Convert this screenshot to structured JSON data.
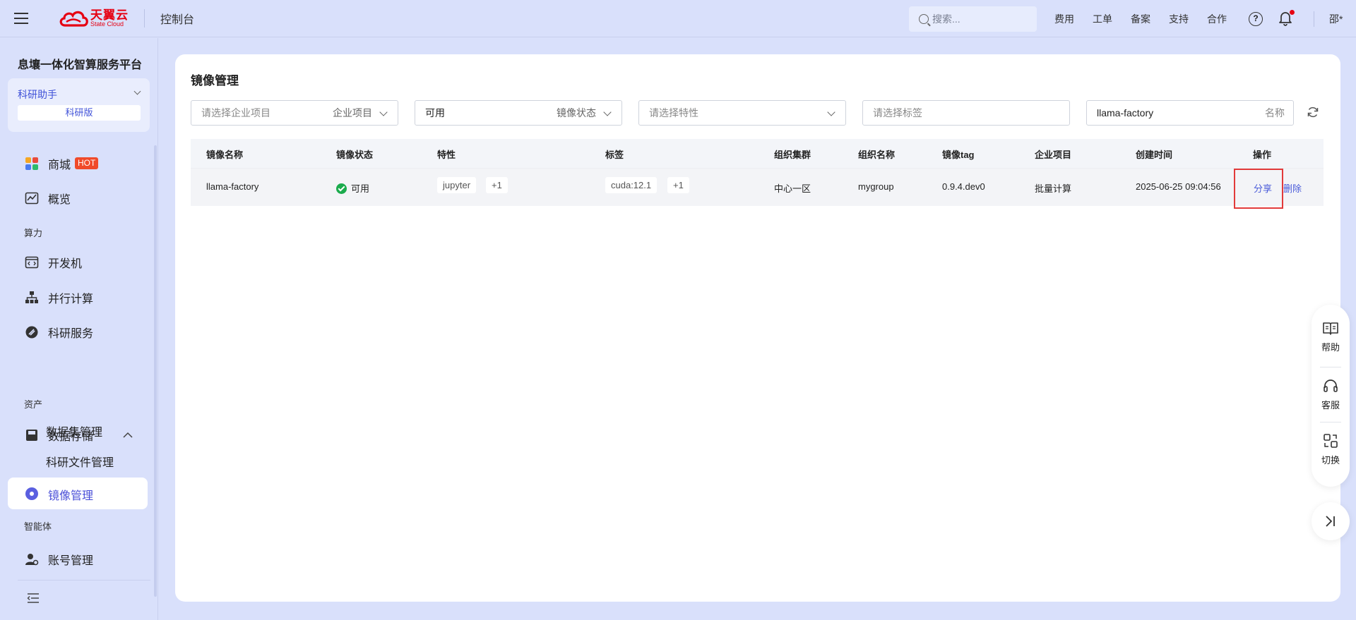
{
  "header": {
    "logo_cn": "天翼云",
    "logo_en": "State Cloud",
    "console_title": "控制台",
    "search_placeholder": "搜索...",
    "nav": [
      "费用",
      "工单",
      "备案",
      "支持",
      "合作"
    ],
    "help_symbol": "?",
    "user_name": "邵*"
  },
  "sidebar": {
    "platform_title": "息壤一体化智算服务平台",
    "assistant": {
      "title": "科研助手",
      "version": "科研版"
    },
    "items": {
      "mall": "商城",
      "hot": "HOT",
      "overview": "概览",
      "section_compute": "算力",
      "dev_machine": "开发机",
      "parallel": "并行计算",
      "research_service": "科研服务",
      "section_assets": "资产",
      "data_storage": "数据存储",
      "dataset_mgmt": "数据集管理",
      "file_mgmt": "科研文件管理",
      "image_mgmt": "镜像管理",
      "section_agent": "智能体",
      "account_mgmt": "账号管理"
    }
  },
  "main": {
    "title": "镜像管理",
    "filters": {
      "project_placeholder": "请选择企业项目",
      "project_suffix": "企业项目",
      "status_value": "可用",
      "status_suffix": "镜像状态",
      "feature_placeholder": "请选择特性",
      "tag_placeholder": "请选择标签",
      "name_value": "llama-factory",
      "name_suffix": "名称"
    },
    "table": {
      "headers": [
        "镜像名称",
        "镜像状态",
        "特性",
        "标签",
        "组织集群",
        "组织名称",
        "镜像tag",
        "企业项目",
        "创建时间",
        "操作"
      ],
      "rows": [
        {
          "name": "llama-factory",
          "status": "可用",
          "feature": "jupyter",
          "feature_more": "+1",
          "tag": "cuda:12.1",
          "tag_more": "+1",
          "cluster": "中心一区",
          "org": "mygroup",
          "image_tag": "0.9.4.dev0",
          "project": "批量计算",
          "created": "2025-06-25 09:04:56",
          "op_share": "分享",
          "op_delete": "删除"
        }
      ]
    }
  },
  "float_panel": {
    "help": "帮助",
    "service": "客服",
    "switch": "切换"
  },
  "colors": {
    "accent": "#4a5bd9",
    "brand": "#e60012",
    "success": "#1bab4d",
    "highlight": "#e23a3a"
  }
}
